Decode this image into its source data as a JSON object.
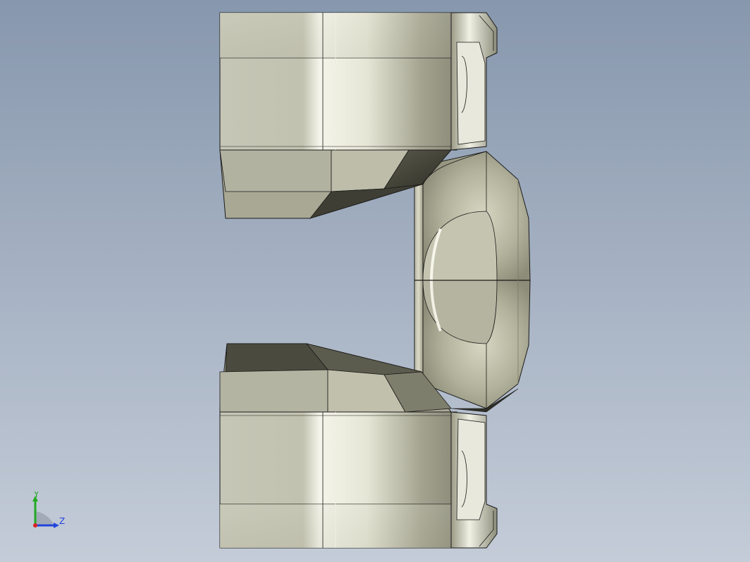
{
  "viewport": {
    "background_top": "#8797ad",
    "background_bottom": "#c4ccd8"
  },
  "model": {
    "name": "yoke-part",
    "face_color": "#b8b8a4",
    "highlight_color": "#f2f2e6",
    "shadow_color": "#4a4a3e",
    "edge_color": "#1a1a1a"
  },
  "triad": {
    "y_label": "Y",
    "z_label": "Z",
    "y_color": "#22aa22",
    "z_color": "#2244dd",
    "x_color": "#dd2222"
  }
}
